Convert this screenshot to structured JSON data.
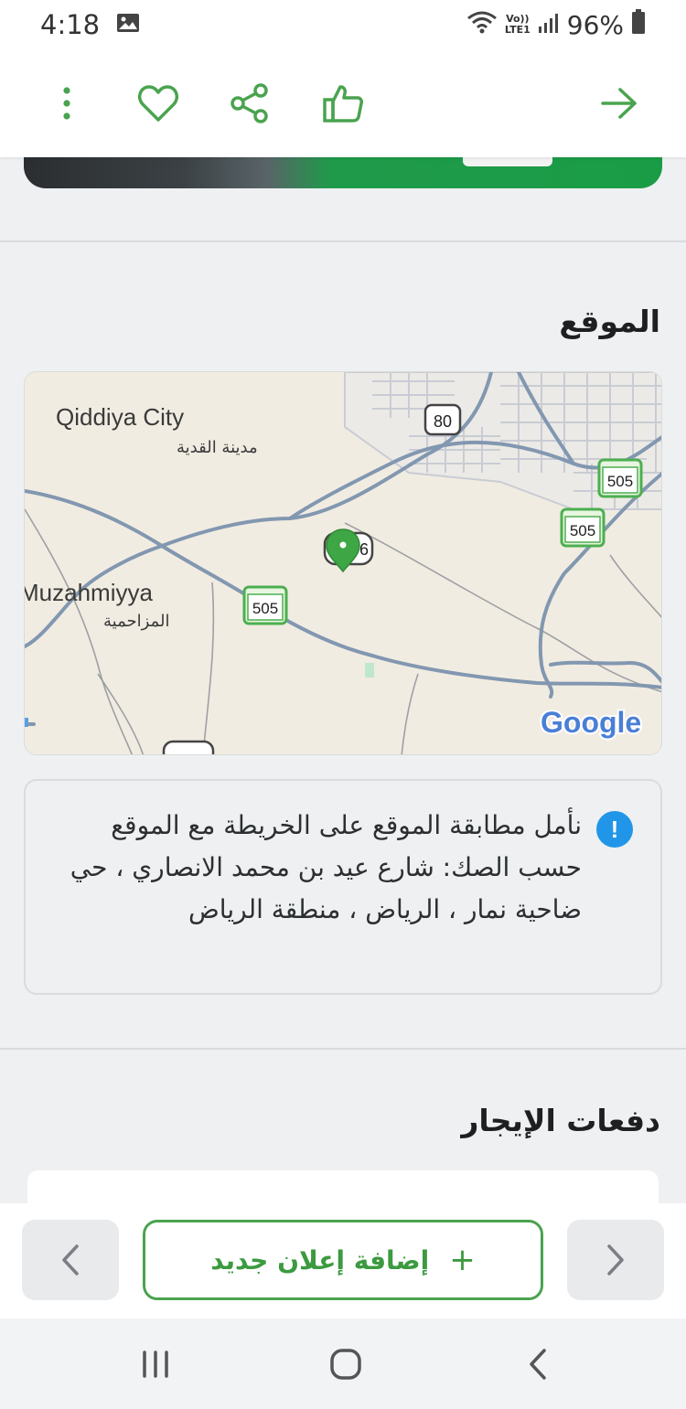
{
  "status_bar": {
    "time": "4:18",
    "lte_label_top": "Vo))",
    "lte_label_bottom": "LTE1",
    "battery": "96%"
  },
  "app_bar": {
    "icons": [
      "more-vertical-icon",
      "heart-icon",
      "share-icon",
      "thumbs-up-icon",
      "arrow-right-icon"
    ]
  },
  "location_section": {
    "title": "الموقع"
  },
  "map": {
    "city_en": "Qiddiya City",
    "city_ar": "مدينة القدية",
    "town_en": "Muzahmiyya",
    "town_ar": "المزاحمية",
    "road_80": "80",
    "road_505": "505",
    "pin_road_label": "6",
    "logo": "Google"
  },
  "info_box": {
    "icon": "!",
    "text": "نأمل مطابقة الموقع على الخريطة مع الموقع حسب الصك: شارع عيد بن محمد الانصاري ، حي ضاحية نمار ، الرياض ، منطقة الرياض"
  },
  "payments_section": {
    "title": "دفعات الإيجار"
  },
  "bottom_bar": {
    "add_plus": "+",
    "add_label": "إضافة إعلان جديد"
  },
  "colors": {
    "brand_green": "#4aa34f",
    "info_blue": "#2196e8",
    "road_blue": "#8096b0"
  }
}
